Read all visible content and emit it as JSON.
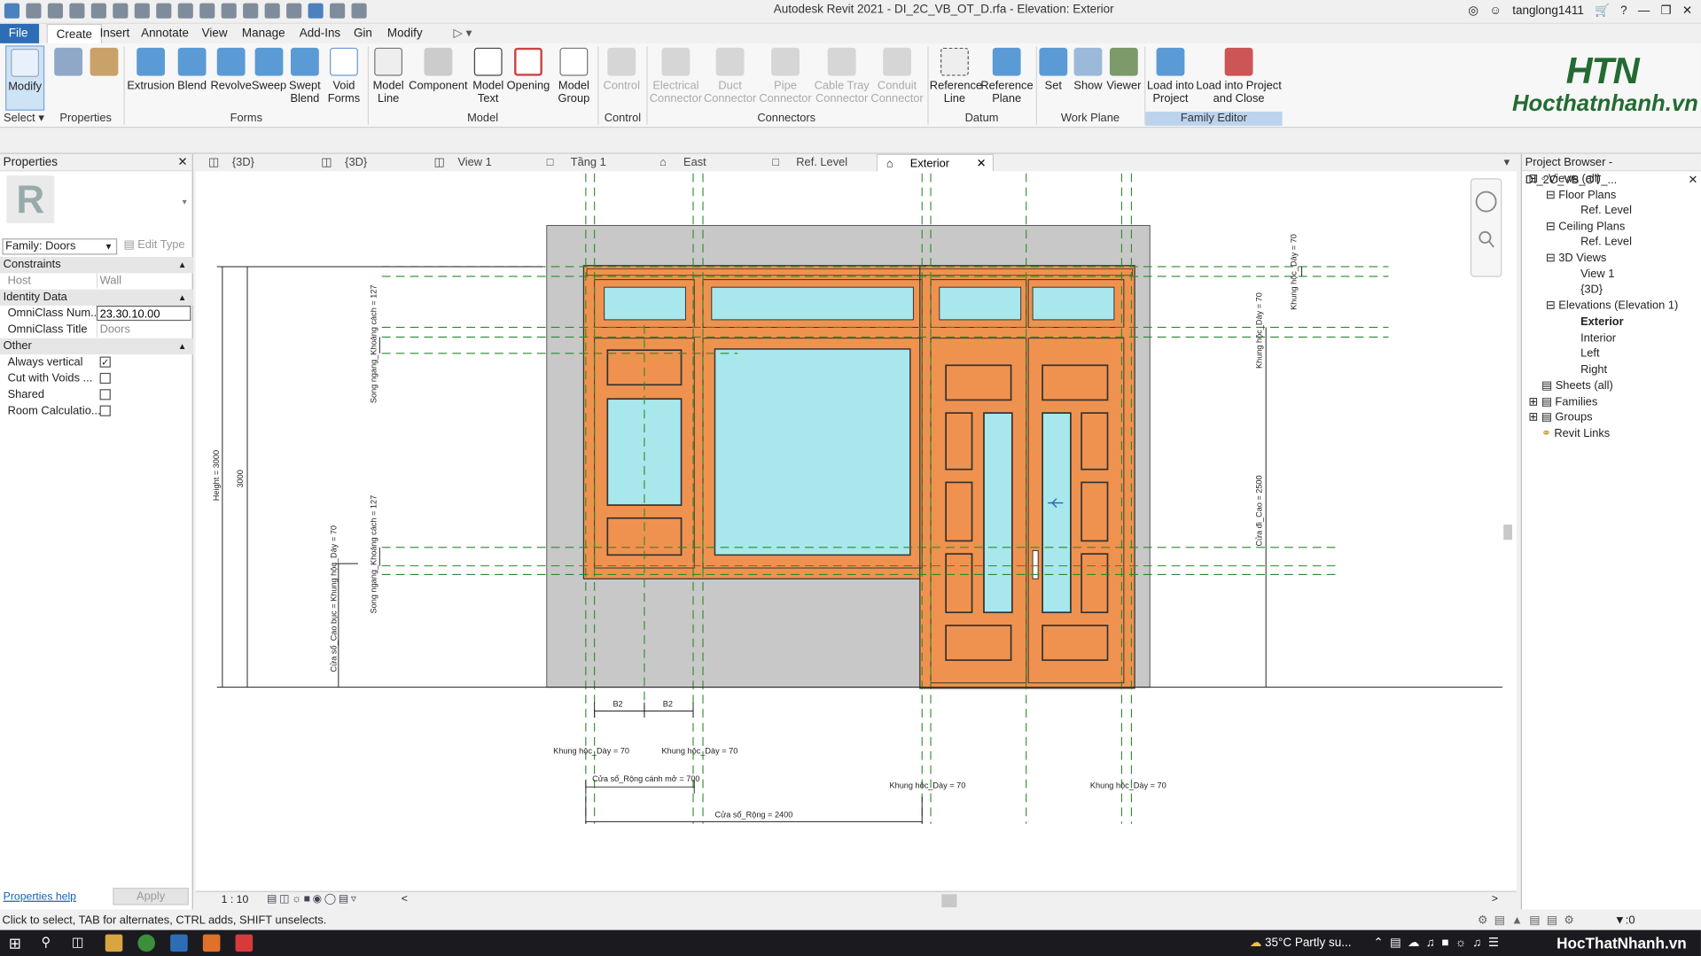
{
  "window": {
    "title": "Autodesk Revit 2021 - DI_2C_VB_OT_D.rfa - Elevation: Exterior",
    "user": "tanglong1411"
  },
  "menu": [
    "File",
    "Create",
    "Insert",
    "Annotate",
    "View",
    "Manage",
    "Add-Ins",
    "Gin",
    "Modify"
  ],
  "ribbon": {
    "buttons": [
      "Modify",
      "Extrusion",
      "Blend",
      "Revolve",
      "Sweep",
      "Swept Blend",
      "Void Forms",
      "Model Line",
      "Component",
      "Model Text",
      "Opening",
      "Model Group",
      "Control",
      "Electrical Connector",
      "Duct Connector",
      "Pipe Connector",
      "Cable Tray Connector",
      "Conduit Connector",
      "Reference Line",
      "Reference Plane",
      "Set",
      "Show",
      "Viewer",
      "Load into Project",
      "Load into Project and Close"
    ],
    "groups": [
      "Select",
      "Properties",
      "Forms",
      "Model",
      "Control",
      "Connectors",
      "Datum",
      "Work Plane",
      "Family Editor"
    ]
  },
  "logo": {
    "top": "HTN",
    "bottom": "Hocthatnhanh.vn"
  },
  "properties": {
    "title": "Properties",
    "family": "Family: Doors",
    "edit_type": "Edit Type",
    "sections": {
      "constraints": "Constraints",
      "identity": "Identity Data",
      "other": "Other"
    },
    "host_label": "Host",
    "host_value": "Wall",
    "omni_num_label": "OmniClass Num...",
    "omni_num_value": "23.30.10.00",
    "omni_title_label": "OmniClass Title",
    "omni_title_value": "Doors",
    "always_vertical": "Always vertical",
    "cut_voids": "Cut with Voids ...",
    "shared": "Shared",
    "room_calc": "Room Calculatio...",
    "help": "Properties help",
    "apply": "Apply"
  },
  "view_tabs": [
    "{3D}",
    "{3D}",
    "View 1",
    "Tầng 1",
    "East",
    "Ref. Level",
    "Exterior"
  ],
  "browser": {
    "title": "Project Browser - DI_2C_VB_OT_...",
    "views_all": "Views (all)",
    "floor_plans": "Floor Plans",
    "ref_level_1": "Ref. Level",
    "ceiling_plans": "Ceiling Plans",
    "ref_level_2": "Ref. Level",
    "views_3d": "3D Views",
    "view1": "View 1",
    "view3d": "{3D}",
    "elevations": "Elevations (Elevation 1)",
    "exterior": "Exterior",
    "interior": "Interior",
    "left": "Left",
    "right": "Right",
    "sheets": "Sheets (all)",
    "families": "Families",
    "groups": "Groups",
    "links": "Revit Links"
  },
  "drawing": {
    "dims": {
      "height": "Height = 3000",
      "h3000": "3000",
      "song_top": "Song ngang_Khoảng cách = 127",
      "song_bot": "Song ngang_Khoảng cách = 127",
      "cua_so_bo": "Cửa sổ_Cao bục = Khung hộc_Dày = 70",
      "khung_day_r": "Khung hộc_Dày = 70",
      "khung_day_r2": "Khung hộc_Dày = 70",
      "cua_di_cao": "Cửa đi_Cao = 2500",
      "b1": "B2",
      "b2": "B2",
      "kd1": "Khung hộc_Dày = 70",
      "kd2": "Khung hộc_Dày = 70",
      "kd3": "Khung hộc_Dày = 70",
      "kd4": "Khung hộc_Dày = 70",
      "cs_rong_canh": "Cửa sổ_Rộng cánh mở = 700",
      "cs_rong": "Cửa sổ_Rộng = 2400"
    }
  },
  "view_control": {
    "scale": "1 : 10"
  },
  "status": {
    "text": "Click to select, TAB for alternates, CTRL adds, SHIFT unselects.",
    "filter": ":0"
  },
  "taskbar": {
    "weather": "35°C  Partly su...",
    "brand": "HocThatNhanh.vn"
  },
  "colors": {
    "frame": "#f0924f",
    "glass": "#a8e8ec",
    "wall": "#c8c8c8",
    "refline": "#2a8a2a",
    "accent": "#2d6db5"
  }
}
